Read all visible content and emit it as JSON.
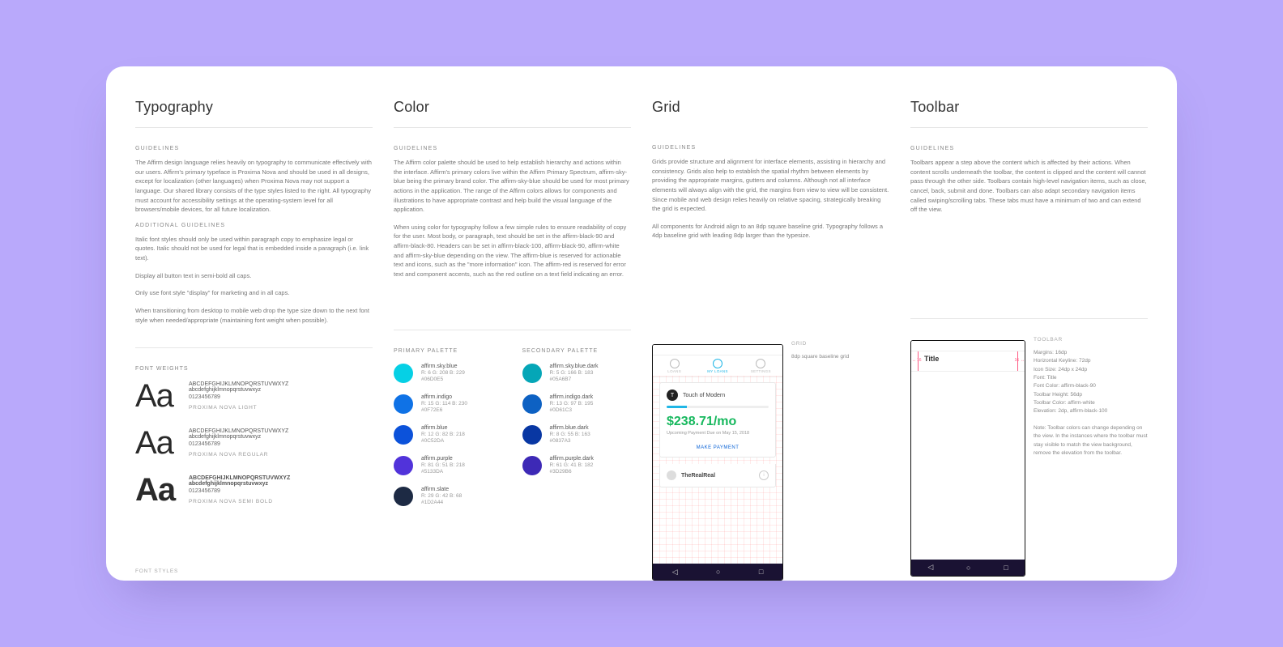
{
  "sections": {
    "typography": {
      "title": "Typography",
      "guidelines_label": "GUIDELINES",
      "guidelines_body": "The Affirm design language relies heavily on typography to communicate effectively with our users. Affirm's primary typeface is Proxima Nova and should be used in all designs, except for localization (other languages) when Proxima Nova may not support a language. Our shared library consists of the type styles listed to the right. All typography must account for accessibility settings at the operating-system level for all browsers/mobile devices, for all future localization.",
      "additional_label": "ADDITIONAL GUIDELINES",
      "additional_items": [
        "Italic font styles should only be used within paragraph copy to emphasize legal or quotes. Italic should not be used for legal that is embedded inside a paragraph (i.e. link text).",
        "Display all button text in semi-bold all caps.",
        "Only use font style \"display\" for marketing and in all caps.",
        "When transitioning from desktop to mobile web drop the type size down to the next font style when needed/appropriate (maintaining font weight when possible)."
      ],
      "font_weights_label": "FONT WEIGHTS",
      "font_styles_label": "FONT STYLES",
      "weights": [
        {
          "sample": "Aa",
          "alpha_upper": "ABCDEFGHIJKLMNOPQRSTUVWXYZ",
          "alpha_lower": "abcdefghijklmnopqrstuvwxyz",
          "nums": "0123456789",
          "name": "PROXIMA NOVA LIGHT",
          "class": "light"
        },
        {
          "sample": "Aa",
          "alpha_upper": "ABCDEFGHIJKLMNOPQRSTUVWXYZ",
          "alpha_lower": "abcdefghijklmnopqrstuvwxyz",
          "nums": "0123456789",
          "name": "PROXIMA NOVA REGULAR",
          "class": "reg"
        },
        {
          "sample": "Aa",
          "alpha_upper": "ABCDEFGHIJKLMNOPQRSTUVWXYZ",
          "alpha_lower": "abcdefghijklmnopqrstuvwxyz",
          "nums": "0123456789",
          "name": "PROXIMA NOVA SEMI BOLD",
          "class": "semi"
        }
      ]
    },
    "color": {
      "title": "Color",
      "guidelines_label": "GUIDELINES",
      "guidelines_body_1": "The Affirm color palette should be used to help establish hierarchy and actions within the interface. Affirm's primary colors live within the Affirm Primary Spectrum, affirm-sky-blue being the primary brand color. The affirm-sky-blue should be used for most primary actions in the application. The range of the Affirm colors allows for components and illustrations to have appropriate contrast and help build the visual language of the application.",
      "guidelines_body_2": "When using color for typography follow a few simple rules to ensure readability of copy for the user. Most body, or paragraph, text should be set in the affirm-black-90 and affirm-black-80. Headers can be set in affirm-black-100, affirm-black-90, affirm-white and affirm-sky-blue depending on the view. The affirm-blue is reserved for actionable text and icons, such as the \"more information\" icon. The affirm-red is reserved for error text and component accents, such as the red outline on a text field indicating an error.",
      "primary_label": "PRIMARY PALETTE",
      "secondary_label": "SECONDARY PALETTE",
      "primary": [
        {
          "name": "affirm.sky.blue",
          "rgb": "R: 6  G: 208  B: 229",
          "hex": "#06D0E5",
          "chip": "#06d0e5"
        },
        {
          "name": "affirm.indigo",
          "rgb": "R: 15  G: 114  B: 230",
          "hex": "#0F72E6",
          "chip": "#0f72e6"
        },
        {
          "name": "affirm.blue",
          "rgb": "R: 12  G: 82  B: 218",
          "hex": "#0C52DA",
          "chip": "#0c52da"
        },
        {
          "name": "affirm.purple",
          "rgb": "R: 81  G: 51  B: 218",
          "hex": "#5133DA",
          "chip": "#5133da"
        },
        {
          "name": "affirm.slate",
          "rgb": "R: 29  G: 42  B: 68",
          "hex": "#1D2A44",
          "chip": "#1d2a44"
        }
      ],
      "secondary": [
        {
          "name": "affirm.sky.blue.dark",
          "rgb": "R: 5  G: 166  B: 183",
          "hex": "#05A6B7",
          "chip": "#05a6b7"
        },
        {
          "name": "affirm.indigo.dark",
          "rgb": "R: 13  G: 97  B: 195",
          "hex": "#0D61C3",
          "chip": "#0d61c3"
        },
        {
          "name": "affirm.blue.dark",
          "rgb": "R: 8  G: 55  B: 163",
          "hex": "#0837A3",
          "chip": "#0837a3"
        },
        {
          "name": "affirm.purple.dark",
          "rgb": "R: 61  G: 41  B: 182",
          "hex": "#3D29B6",
          "chip": "#3d29b6"
        }
      ]
    },
    "grid": {
      "title": "Grid",
      "guidelines_label": "GUIDELINES",
      "guidelines_body_1": "Grids provide structure and alignment for interface elements, assisting in hierarchy and consistency. Grids also help to establish the spatial rhythm between elements by providing the appropriate margins, gutters and columns. Although not all interface elements will always align with the grid, the margins from view to view will be consistent. Since mobile and web design relies heavily on relative spacing, strategically breaking the grid is expected.",
      "guidelines_body_2": "All components for Android align to an 8dp square baseline grid. Typography follows a 4dp baseline grid with leading 8dp larger than the typesize.",
      "aside_label": "GRID",
      "aside_text": "8dp square baseline grid",
      "phone": {
        "tabs": [
          "LOANS",
          "MY LOANS",
          "SETTINGS"
        ],
        "merchant_initial": "T",
        "merchant": "Touch of Modern",
        "amount": "$238.71/mo",
        "due": "Upcoming Payment Due on May 15, 2018",
        "make_payment": "MAKE PAYMENT",
        "promo": "TheRealReal",
        "nav": [
          "◁",
          "○",
          "□"
        ]
      }
    },
    "toolbar": {
      "title": "Toolbar",
      "guidelines_label": "GUIDELINES",
      "guidelines_body": "Toolbars appear a step above the content which is affected by their actions. When content scrolls underneath the toolbar, the content is clipped and the content will cannot pass through the other side. Toolbars contain high-level navigation items, such as close, cancel, back, submit and done. Toolbars can also adapt secondary navigation items called swiping/scrolling tabs. These tabs must have a minimum of two and can extend off the view.",
      "aside_label": "TOOLBAR",
      "specs": [
        "Margins: 16dp",
        "Horizontal Keyline: 72dp",
        "Icon Size: 24dp x 24dp",
        "Font: Title",
        "Font Color: affirm-black-90",
        "Toolbar Height: 56dp",
        "Toolbar Color: affirm-white",
        "Elevation: 2dp, affirm-black-100"
      ],
      "note": "Note: Toolbar colors can change depending on the view. In the instances where the toolbar must stay visible to match the view background, remove the elevation from the toolbar.",
      "phone": {
        "title": "Title",
        "dim_left": "16",
        "dim_right": "16",
        "nav": [
          "◁",
          "○",
          "□"
        ]
      }
    }
  }
}
